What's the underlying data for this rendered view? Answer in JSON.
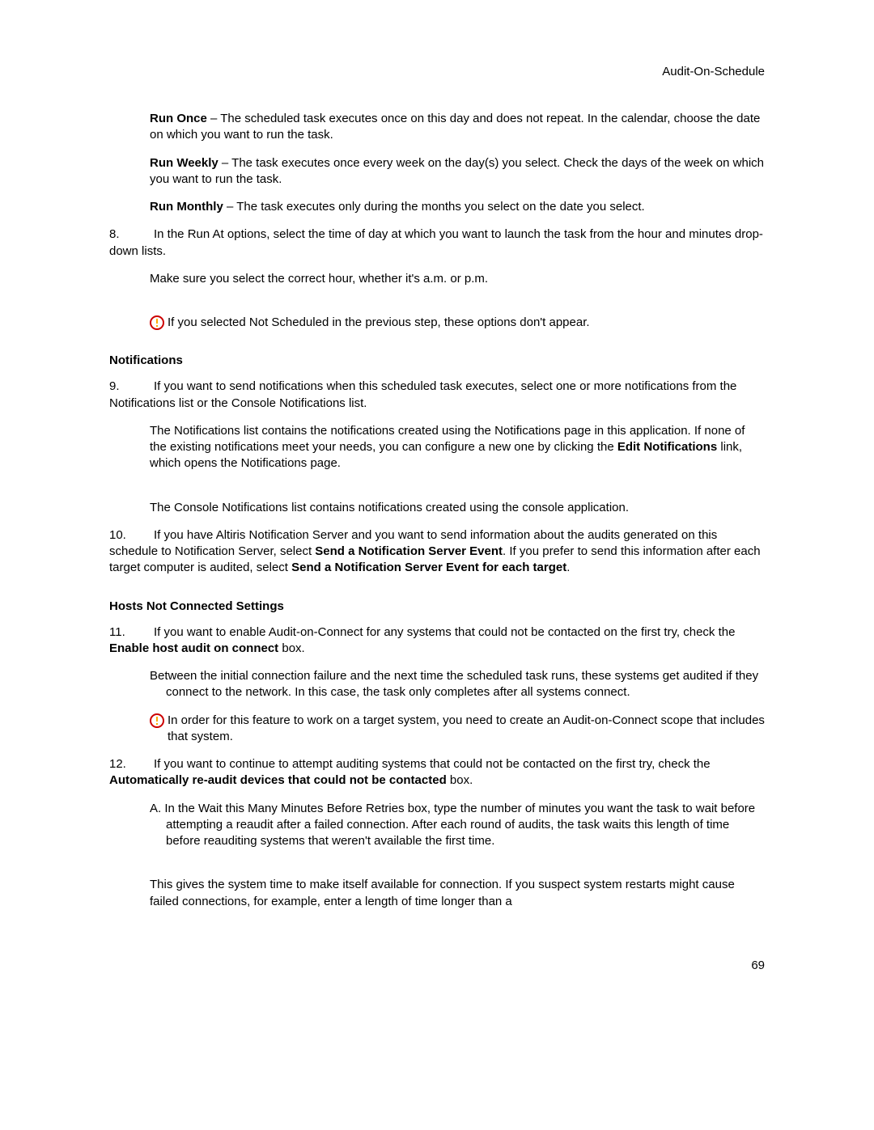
{
  "header": {
    "title": "Audit-On-Schedule"
  },
  "runOnce": {
    "label": "Run Once",
    "text": " – The scheduled task executes once on this day and does not repeat. In the calendar, choose the date on which you want to run the task."
  },
  "runWeekly": {
    "label": "Run Weekly",
    "text": " – The task executes once every week on the day(s) you select. Check the days of the week on which you want to run the task."
  },
  "runMonthly": {
    "label": "Run Monthly",
    "text": " – The task executes only during the months you select on the date you select."
  },
  "step8": {
    "num": "8.",
    "text": "In the Run At options, select the time of day at which you want to launch the task from the hour and minutes drop-down lists.",
    "sub": "Make sure you select the correct hour, whether it's a.m. or p.m."
  },
  "note1": "If you selected Not Scheduled in the previous step, these options don't appear.",
  "notificationsHeading": "Notifications",
  "step9": {
    "num": "9.",
    "text": "If you want to send notifications when this scheduled task executes, select one or more notifications from the Notifications list or the Console Notifications list.",
    "sub1a": "The Notifications list contains the notifications created using the Notifications page in this application. If none of the existing notifications meet your needs, you can configure a new one by clicking the ",
    "sub1bold": "Edit Notifications",
    "sub1b": " link, which opens the Notifications page.",
    "sub2": "The Console Notifications list contains notifications created using the console application."
  },
  "step10": {
    "num": "10.",
    "text1": "If you have Altiris Notification Server and you want to send information about the audits generated on this schedule to Notification Server, select ",
    "bold1": "Send a Notification Server Event",
    "text2": ". If you prefer to send this information after each target computer is audited, select ",
    "bold2": "Send a Notification Server Event for each target",
    "text3": "."
  },
  "hostsHeading": "Hosts Not Connected Settings",
  "step11": {
    "num": "11.",
    "text1": "If you want to enable Audit-on-Connect for any systems that could not be contacted on the first try, check the ",
    "bold": "Enable host audit on connect",
    "text2": " box.",
    "sub": "Between the initial connection failure and the next time the scheduled task runs, these systems get audited if they connect to the network. In this case, the task only completes after all systems connect."
  },
  "note2": "In order for this feature to work on a target system, you need to create an Audit-on-Connect scope that includes that system.",
  "step12": {
    "num": "12.",
    "text1": "If you want to continue to attempt auditing systems that could not be contacted on the first try, check the ",
    "bold": "Automatically re-audit devices that could not be contacted",
    "text2": " box.",
    "subA": "A. In the Wait this Many Minutes Before Retries box, type the number of minutes you want the task to wait before attempting a reaudit after a failed connection. After each round of audits, the task waits this length of time before reauditing systems that weren't available the first time.",
    "subB": "This gives the system time to make itself available for connection. If you suspect system restarts might cause failed connections, for example, enter a length of time longer than a"
  },
  "pageNumber": "69"
}
